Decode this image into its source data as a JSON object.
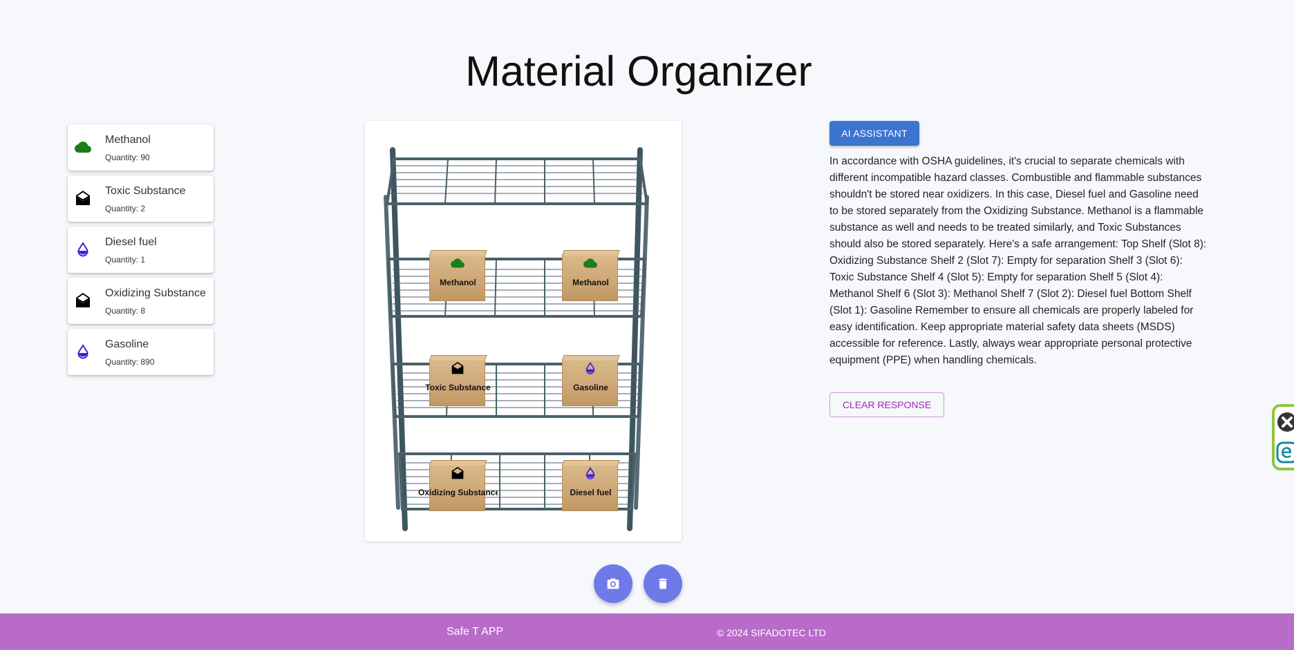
{
  "page": {
    "title": "Material Organizer"
  },
  "materials": [
    {
      "name": "Methanol",
      "quantity": "Quantity: 90",
      "icon": "cloud-icon",
      "color": "#1a7f1a"
    },
    {
      "name": "Toxic Substance",
      "quantity": "Quantity: 2",
      "icon": "envelope-open-icon",
      "color": "#000000"
    },
    {
      "name": "Diesel fuel",
      "quantity": "Quantity: 1",
      "icon": "droplet-icon",
      "color": "#3b1fe0"
    },
    {
      "name": "Oxidizing Substance",
      "quantity": "Quantity: 8",
      "icon": "envelope-open-icon",
      "color": "#000000"
    },
    {
      "name": "Gasoline",
      "quantity": "Quantity: 890",
      "icon": "droplet-icon",
      "color": "#3b1fe0"
    }
  ],
  "shelf": {
    "boxes": [
      {
        "label": "Methanol",
        "icon": "cloud-icon"
      },
      {
        "label": "Methanol",
        "icon": "cloud-icon"
      },
      {
        "label": "Toxic Substance",
        "icon": "envelope-open-icon"
      },
      {
        "label": "Gasoline",
        "icon": "droplet-icon"
      },
      {
        "label": "Oxidizing Substance",
        "icon": "envelope-open-icon"
      },
      {
        "label": "Diesel fuel",
        "icon": "droplet-icon"
      }
    ]
  },
  "assistant": {
    "button_label": "AI ASSISTANT",
    "response": "In accordance with OSHA guidelines, it's crucial to separate chemicals with different incompatible hazard classes. Combustible and flammable substances shouldn't be stored near oxidizers. In this case, Diesel fuel and Gasoline need to be stored separately from the Oxidizing Substance. Methanol is a flammable substance as well and needs to be treated similarly, and Toxic Substances should also be stored separately. Here's a safe arrangement: Top Shelf (Slot 8): Oxidizing Substance Shelf 2 (Slot 7): Empty for separation Shelf 3 (Slot 6): Toxic Substance Shelf 4 (Slot 5): Empty for separation Shelf 5 (Slot 4): Methanol Shelf 6 (Slot 3): Methanol Shelf 7 (Slot 2): Diesel fuel Bottom Shelf (Slot 1): Gasoline Remember to ensure all chemicals are properly labeled for easy identification. Keep appropriate material safety data sheets (MSDS) accessible for reference. Lastly, always wear appropriate personal protective equipment (PPE) when handling chemicals.",
    "clear_label": "CLEAR RESPONSE"
  },
  "actions": {
    "camera_icon": "camera-icon",
    "delete_icon": "trash-icon",
    "color": "#6f7ae8"
  },
  "footer": {
    "app_name": "Safe T APP",
    "copyright": "© 2024 SIFADOTEC LTD",
    "color": "#b96bc9"
  }
}
